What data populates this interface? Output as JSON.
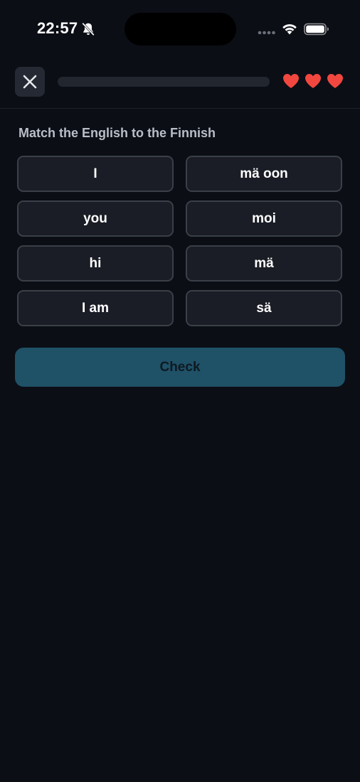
{
  "status_bar": {
    "time": "22:57",
    "icons": [
      "bell-slash-icon",
      "cellular-signal-icon",
      "wifi-icon",
      "battery-icon"
    ]
  },
  "header": {
    "close_icon": "close-icon",
    "progress_fraction": 0,
    "hearts": 3,
    "heart_color": "#f2473f"
  },
  "exercise": {
    "prompt": "Match the English to the Finnish",
    "left_column": [
      "I",
      "you",
      "hi",
      "I am"
    ],
    "right_column": [
      "mä oon",
      "moi",
      "mä",
      "sä"
    ],
    "check_label": "Check"
  },
  "colors": {
    "background": "#0b0e15",
    "tile_background": "#1a1d25",
    "tile_border": "#3a3f48",
    "check_button": "#1f5167",
    "progress_track": "#22272f"
  }
}
